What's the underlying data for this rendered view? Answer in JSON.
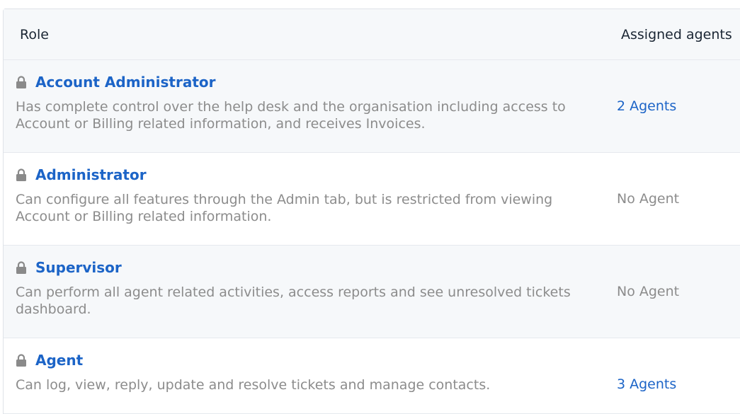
{
  "header": {
    "role": "Role",
    "assigned_agents": "Assigned agents"
  },
  "roles": [
    {
      "name": "Account Administrator",
      "description": "Has complete control over the help desk and the organisation including access to Account or Billing related information, and receives Invoices.",
      "agents": "2 Agents",
      "icon": "lock-icon"
    },
    {
      "name": "Administrator",
      "description": "Can configure all features through the Admin tab, but is restricted from viewing Account or Billing related information.",
      "agents": "No Agent",
      "icon": "lock-icon"
    },
    {
      "name": "Supervisor",
      "description": "Can perform all agent related activities, access reports and see unresolved tickets dashboard.",
      "agents": "No Agent",
      "icon": "lock-icon"
    },
    {
      "name": "Agent",
      "description": "Can log, view, reply, update and resolve tickets and manage contacts.",
      "agents": "3 Agents",
      "icon": "lock-icon"
    }
  ],
  "colors": {
    "link": "#1c64c7",
    "muted_text": "#8c8c8c",
    "header_bg": "#f6f8fa"
  }
}
